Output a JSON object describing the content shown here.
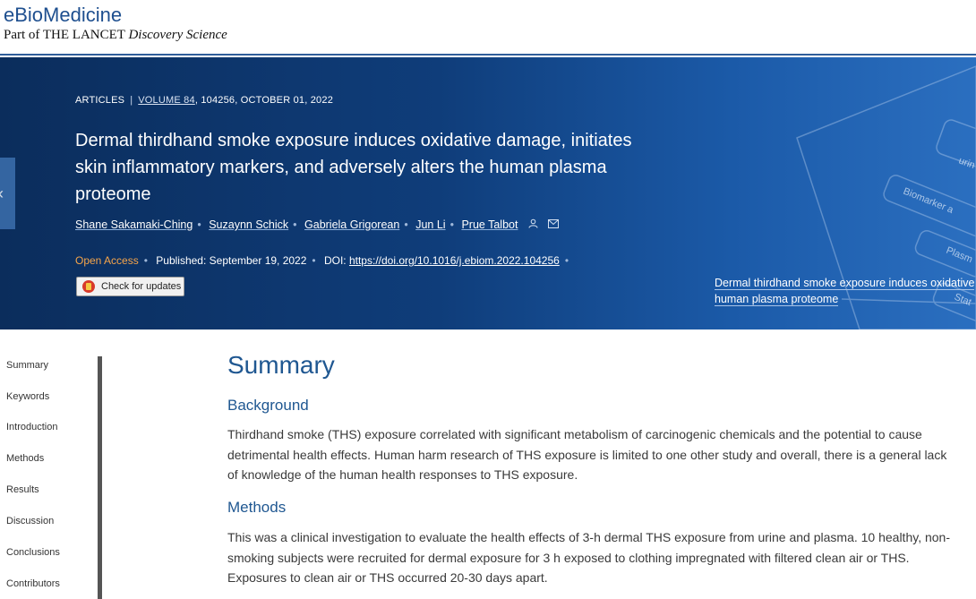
{
  "header": {
    "brand": "eBioMedicine",
    "tagline_prefix": "Part of THE LANCET",
    "tagline_suffix": "Discovery Science"
  },
  "hero": {
    "article_type": "ARTICLES",
    "volume": "VOLUME 84",
    "issue_info": ", 104256, OCTOBER 01, 2022",
    "title": "Dermal thirdhand smoke exposure induces oxidative damage, initiates skin inflammatory markers, and adversely alters the human plasma proteome",
    "authors": [
      "Shane Sakamaki-Ching",
      "Suzaynn Schick",
      "Gabriela Grigorean",
      "Jun Li",
      "Prue Talbot"
    ],
    "open_access": "Open Access",
    "published_label": "Published:",
    "published_date": "September 19, 2022",
    "doi_label": "DOI:",
    "doi": "https://doi.org/10.1016/j.ebiom.2022.104256",
    "check_updates": "Check for updates",
    "caption": "Dermal thirdhand smoke exposure induces oxidative human plasma proteome",
    "caption_line1": "Dermal thirdhand smoke exposure induces oxidative",
    "caption_line2": "human plasma proteome",
    "art_labels": [
      "urin",
      "Biomarker a",
      "Plasm",
      "Stat"
    ],
    "icons": [
      "left-chevron-icon",
      "person-icon",
      "envelope-icon"
    ]
  },
  "sidebar": {
    "items": [
      "Summary",
      "Keywords",
      "Introduction",
      "Methods",
      "Results",
      "Discussion",
      "Conclusions",
      "Contributors"
    ]
  },
  "content": {
    "summary_heading": "Summary",
    "background_heading": "Background",
    "background_text": "Thirdhand smoke (THS) exposure correlated with significant metabolism of carcinogenic chemicals and the potential to cause detrimental health effects. Human harm research of THS exposure is limited to one other study and overall, there is a general lack of knowledge of the human health responses to THS exposure.",
    "methods_heading": "Methods",
    "methods_text": "This was a clinical investigation to evaluate the health effects of 3-h dermal THS exposure from urine and plasma. 10 healthy, non-smoking subjects were recruited for dermal exposure for 3 h exposed to clothing impregnated with filtered clean air or THS. Exposures to clean air or THS occurred 20-30 days apart."
  },
  "colors": {
    "brand": "#1e4f8f",
    "hero_dark": "#0b2d5c",
    "hero_light": "#2b6fc0",
    "open_access": "#f6a54a",
    "heading": "#1f5791"
  }
}
